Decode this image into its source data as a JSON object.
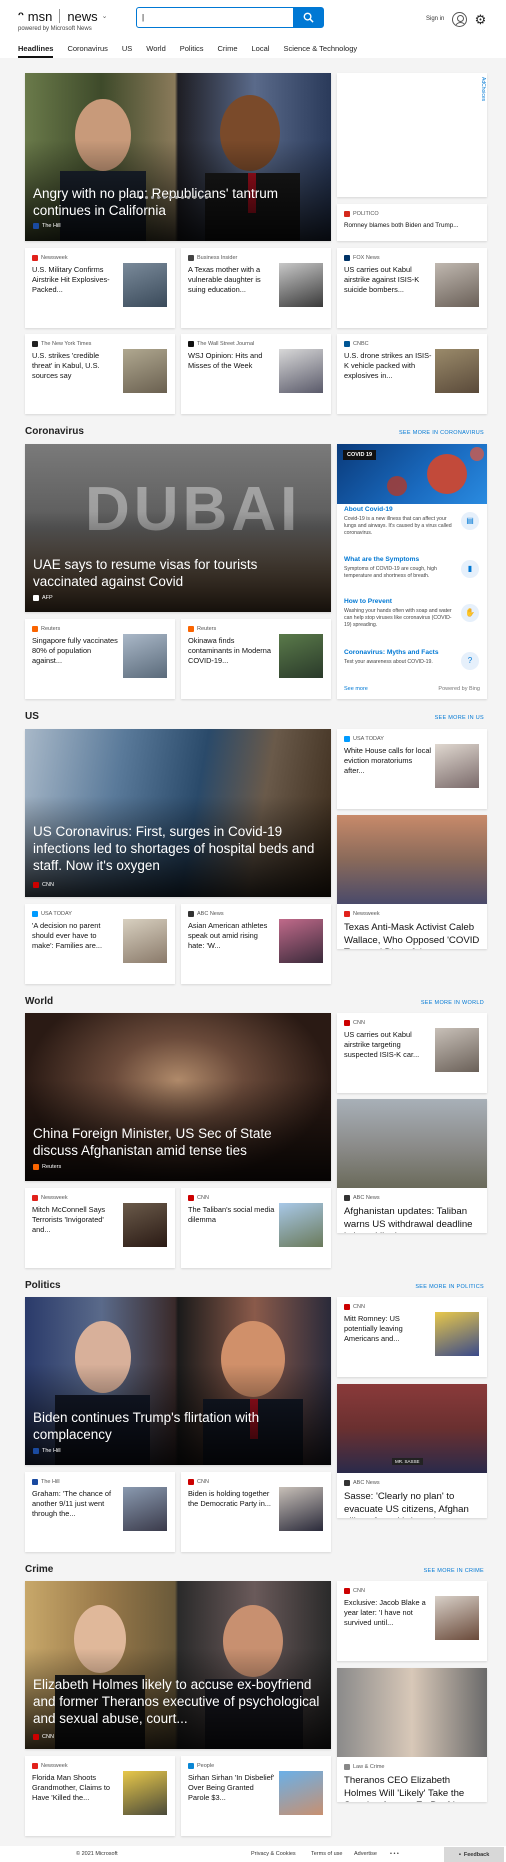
{
  "header": {
    "logo": "msn",
    "section": "news",
    "powered_by": "powered by Microsoft News",
    "search": {
      "value": "|",
      "placeholder": ""
    },
    "sign_in": "Sign in",
    "nav": [
      "Headlines",
      "Coronavirus",
      "US",
      "World",
      "Politics",
      "Crime",
      "Local",
      "Science & Technology"
    ]
  },
  "ad": {
    "label": "AdChoices"
  },
  "headlines": {
    "hero": {
      "title": "Angry with no plan: Republicans' tantrum continues in California",
      "source": "The Hill"
    },
    "side": {
      "source": "POLITICO",
      "title": "Romney blames both Biden and Trump..."
    },
    "cards": [
      {
        "source": "Newsweek",
        "title": "U.S. Military Confirms Airstrike Hit Explosives-Packed..."
      },
      {
        "source": "Business Insider",
        "title": "A Texas mother with a vulnerable daughter is suing education..."
      },
      {
        "source": "FOX News",
        "title": "US carries out Kabul airstrike against ISIS-K suicide bombers..."
      },
      {
        "source": "The New York Times",
        "title": "U.S. strikes 'credible threat' in Kabul, U.S. sources say"
      },
      {
        "source": "The Wall Street Journal",
        "title": "WSJ Opinion: Hits and Misses of the Week"
      },
      {
        "source": "CNBC",
        "title": "U.S. drone strikes an ISIS-K vehicle packed with explosives in..."
      }
    ]
  },
  "coronavirus": {
    "heading": "Coronavirus",
    "more": "SEE MORE IN CORONAVIRUS",
    "hero": {
      "title": "UAE says to resume visas for tourists vaccinated against Covid",
      "source": "AFP",
      "image_text": "DUBAI"
    },
    "cards": [
      {
        "source": "Reuters",
        "title": "Singapore fully vaccinates 80% of population against..."
      },
      {
        "source": "Reuters",
        "title": "Okinawa finds contaminants in Moderna COVID-19..."
      }
    ],
    "widget": {
      "badge": "COVID 19",
      "items": [
        {
          "title": "About Covid-19",
          "text": "Covid-19 is a new illness that can affect your lungs and airways. It's caused by a virus called coronavirus."
        },
        {
          "title": "What are the Symptoms",
          "text": "Symptoms of COVID-19 are cough, high temperature and shortness of breath."
        },
        {
          "title": "How to Prevent",
          "text": "Washing your hands often with soap and water can help stop viruses like coronavirus (COVID-19) spreading."
        },
        {
          "title": "Coronavirus: Myths and Facts",
          "text": "Test your awareness about COVID-19."
        }
      ],
      "see_more": "See more",
      "powered": "Powered by Bing"
    }
  },
  "us": {
    "heading": "US",
    "more": "SEE MORE IN US",
    "hero": {
      "title": "US Coronavirus: First, surges in Covid-19 infections led to shortages of hospital beds and staff. Now it's oxygen",
      "source": "CNN"
    },
    "side": {
      "source": "USA TODAY",
      "title": "White House calls for local eviction moratoriums after..."
    },
    "big": {
      "source": "Newsweek",
      "title": "Texas Anti-Mask Activist Caleb Wallace, Who Opposed 'COVID Tyranny,' Dies of th..."
    },
    "cards": [
      {
        "source": "USA TODAY",
        "title": "'A decision no parent should ever have to make': Families are..."
      },
      {
        "source": "ABC News",
        "title": "Asian American athletes speak out amid rising hate: 'W..."
      }
    ]
  },
  "world": {
    "heading": "World",
    "more": "SEE MORE IN WORLD",
    "hero": {
      "title": "China Foreign Minister, US Sec of State discuss Afghanistan amid tense ties",
      "source": "Reuters"
    },
    "side": {
      "source": "CNN",
      "title": "US carries out Kabul airstrike targeting suspected ISIS-K car..."
    },
    "big": {
      "source": "ABC News",
      "title": "Afghanistan updates: Taliban warns US withdrawal deadline is 'a red line'"
    },
    "cards": [
      {
        "source": "Newsweek",
        "title": "Mitch McConnell Says Terrorists 'Invigorated' and..."
      },
      {
        "source": "CNN",
        "title": "The Taliban's social media dilemma"
      }
    ]
  },
  "politics": {
    "heading": "Politics",
    "more": "SEE MORE IN POLITICS",
    "hero": {
      "title": "Biden continues Trump's flirtation with complacency",
      "source": "The Hill"
    },
    "side": {
      "source": "CNN",
      "title": "Mitt Romney: US potentially leaving Americans and..."
    },
    "big": {
      "source": "ABC News",
      "title": "Sasse: 'Clearly no plan' to evacuate US citizens, Afghan allies after withdrawal",
      "image_text": "MR. SASSE"
    },
    "cards": [
      {
        "source": "The Hill",
        "title": "Graham: 'The chance of another 9/11 just went through the..."
      },
      {
        "source": "CNN",
        "title": "Biden is holding together the Democratic Party in..."
      }
    ]
  },
  "crime": {
    "heading": "Crime",
    "more": "SEE MORE IN CRIME",
    "hero": {
      "title": "Elizabeth Holmes likely to accuse ex-boyfriend and former Theranos executive of psychological and sexual abuse, court...",
      "source": "CNN"
    },
    "side": {
      "source": "CNN",
      "title": "Exclusive: Jacob Blake a year later: 'I have not survived until..."
    },
    "big": {
      "source": "Law & Crime",
      "title": "Theranos CEO Elizabeth Holmes Will 'Likely' Take the Stand to Accuse Ex-Boyfrie..."
    },
    "cards": [
      {
        "source": "Newsweek",
        "title": "Florida Man Shoots Grandmother, Claims to Have 'Killed the..."
      },
      {
        "source": "People",
        "title": "Sirhan Sirhan 'In Disbelief' Over Being Granted Parole $3..."
      }
    ]
  },
  "footer": {
    "copyright": "© 2021 Microsoft",
    "privacy": "Privacy & Cookies",
    "terms": "Terms of use",
    "advertise": "Advertise",
    "ellipsis": "• • •",
    "feedback": "Feedback"
  },
  "colors": {
    "accent": "#0078d4",
    "cnn": "#cc0000",
    "newsweek": "#e1211b",
    "politico": "#d4281c",
    "fox": "#003366",
    "reuters": "#fa6400",
    "usatoday": "#009bff"
  }
}
